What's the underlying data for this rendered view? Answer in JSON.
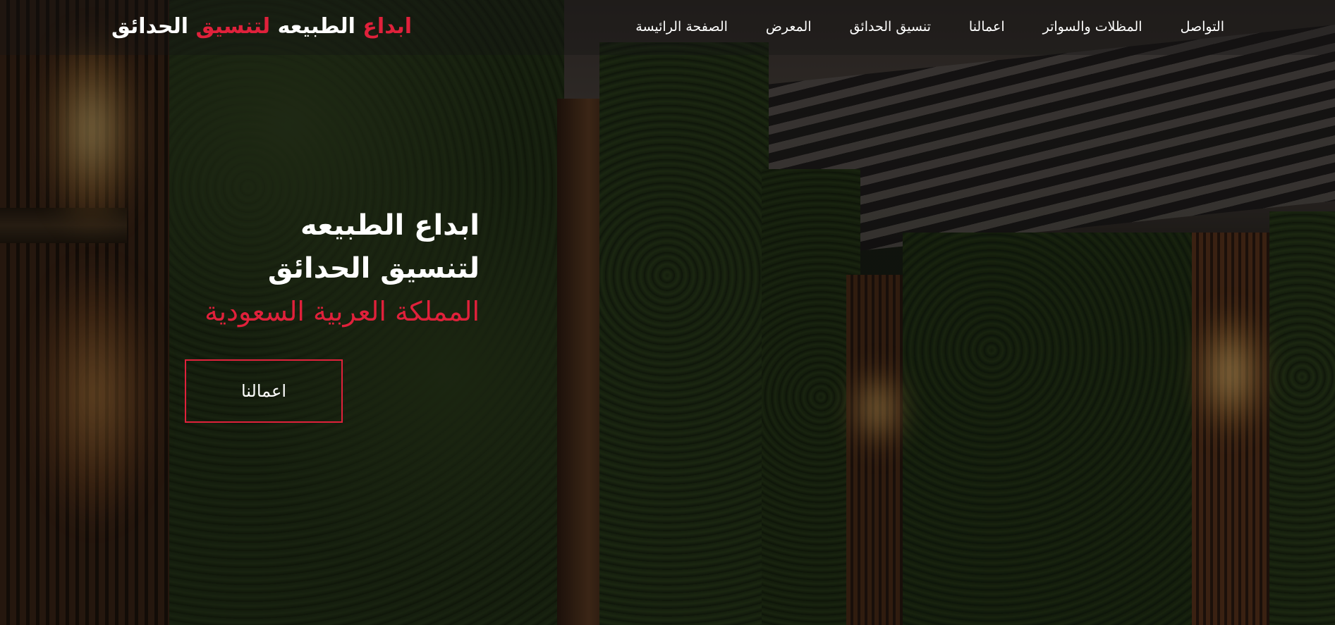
{
  "brand": {
    "part1": "ابداع",
    "part2": "الطبيعه",
    "part3": "لتنسيق",
    "part4": "الحدائق"
  },
  "nav": {
    "items": [
      {
        "label": "الصفحة الرائيسة"
      },
      {
        "label": "المعرض"
      },
      {
        "label": "تنسيق الحدائق"
      },
      {
        "label": "اعمالنا"
      },
      {
        "label": "المظلات والسواتر"
      },
      {
        "label": "التواصل"
      }
    ]
  },
  "hero": {
    "line1": "ابداع الطبيعه",
    "line2": "لتنسيق الحدائق",
    "line3": "المملكة العربية السعودية",
    "cta_label": "اعمالنا"
  },
  "colors": {
    "accent": "#e0213b",
    "text": "#ffffff"
  }
}
